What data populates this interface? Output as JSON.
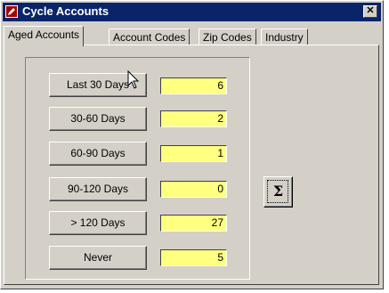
{
  "window": {
    "title": "Cycle Accounts",
    "close_symbol": "✕",
    "app_icon": "pencil-icon",
    "active_title_color": "#0a246a",
    "field_color": "#ffff80"
  },
  "tabs": [
    {
      "label": "Aged Accounts",
      "active": true
    },
    {
      "label": "Account Codes",
      "active": false
    },
    {
      "label": "Zip Codes",
      "active": false
    },
    {
      "label": "Industry",
      "active": false
    }
  ],
  "rows": [
    {
      "label": "Last 30 Days",
      "value": "6"
    },
    {
      "label": "30-60 Days",
      "value": "2"
    },
    {
      "label": "60-90 Days",
      "value": "1"
    },
    {
      "label": "90-120  Days",
      "value": "0"
    },
    {
      "label": "> 120 Days",
      "value": "27"
    },
    {
      "label": "Never",
      "value": "5"
    }
  ],
  "sum_button": {
    "symbol": "Σ",
    "icon": "sigma-icon"
  }
}
